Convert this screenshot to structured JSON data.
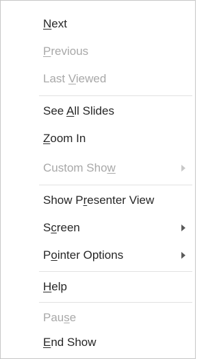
{
  "menu": {
    "items": [
      {
        "pre": "",
        "u": "N",
        "post": "ext",
        "disabled": false,
        "submenu": false
      },
      {
        "pre": "",
        "u": "P",
        "post": "revious",
        "disabled": true,
        "submenu": false
      },
      {
        "pre": "Last ",
        "u": "V",
        "post": "iewed",
        "disabled": true,
        "submenu": false
      },
      {
        "pre": "See ",
        "u": "A",
        "post": "ll Slides",
        "disabled": false,
        "submenu": false
      },
      {
        "pre": "",
        "u": "Z",
        "post": "oom In",
        "disabled": false,
        "submenu": false
      },
      {
        "pre": "Custom Sho",
        "u": "w",
        "post": "",
        "disabled": true,
        "submenu": true
      },
      {
        "pre": "Show P",
        "u": "r",
        "post": "esenter View",
        "disabled": false,
        "submenu": false
      },
      {
        "pre": "S",
        "u": "c",
        "post": "reen",
        "disabled": false,
        "submenu": true
      },
      {
        "pre": "P",
        "u": "o",
        "post": "inter Options",
        "disabled": false,
        "submenu": true
      },
      {
        "pre": "",
        "u": "H",
        "post": "elp",
        "disabled": false,
        "submenu": false
      },
      {
        "pre": "Pau",
        "u": "s",
        "post": "e",
        "disabled": true,
        "submenu": false
      },
      {
        "pre": "",
        "u": "E",
        "post": "nd Show",
        "disabled": false,
        "submenu": false
      }
    ]
  },
  "colors": {
    "text": "#262626",
    "disabled": "#a8a8a8",
    "separator": "#e1e1e1",
    "border": "#c6c6c6"
  }
}
